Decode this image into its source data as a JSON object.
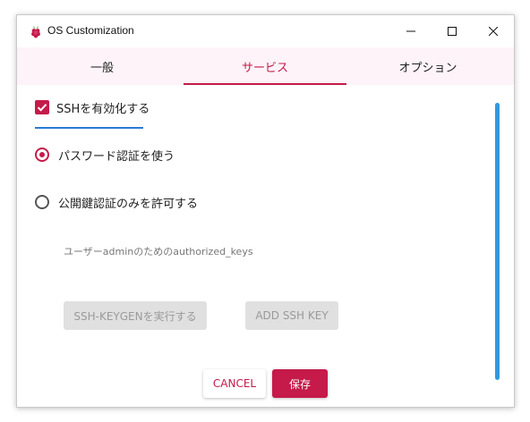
{
  "window": {
    "title": "OS Customization",
    "app_icon": "raspberry-icon",
    "controls": [
      "minimize-icon",
      "maximize-icon",
      "close-icon"
    ]
  },
  "tabs": [
    {
      "label": "一般",
      "active": false
    },
    {
      "label": "サービス",
      "active": true
    },
    {
      "label": "オプション",
      "active": false
    }
  ],
  "ssh": {
    "enable_label": "SSHを有効化する",
    "enable_checked": true,
    "auth_options": [
      {
        "label": "パスワード認証を使う",
        "selected": true
      },
      {
        "label": "公開鍵認証のみを許可する",
        "selected": false
      }
    ],
    "keys_label": "ユーザーadminのためのauthorized_keys"
  },
  "buttons": {
    "keygen": "SSH-KEYGENを実行する",
    "add_key": "ADD SSH KEY",
    "cancel": "CANCEL",
    "save": "保存"
  },
  "colors": {
    "accent": "#c51a4a",
    "tab_background": "#fdf3f8",
    "scrollbar": "#3498db",
    "disabled_button": "#e0e0e0",
    "focus_underline": "#2a7ad6"
  }
}
